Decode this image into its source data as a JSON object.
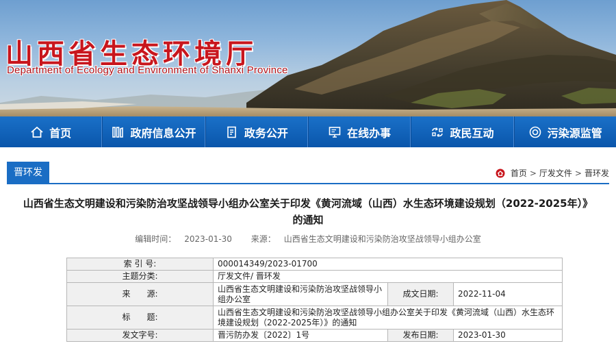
{
  "header": {
    "site_title": "山西省生态环境厅",
    "site_subtitle": "Department of Ecology and Environment of Shanxi Province"
  },
  "nav": {
    "items": [
      {
        "label": "首页",
        "icon": "home-icon"
      },
      {
        "label": "政府信息公开",
        "icon": "info-columns-icon"
      },
      {
        "label": "政务公开",
        "icon": "document-icon"
      },
      {
        "label": "在线办事",
        "icon": "monitor-icon"
      },
      {
        "label": "政民互动",
        "icon": "interaction-icon"
      },
      {
        "label": "污染源监管",
        "icon": "target-icon"
      }
    ]
  },
  "section": {
    "tag": "晋环发",
    "breadcrumb": [
      "首页",
      "厅发文件",
      "晋环发"
    ],
    "breadcrumb_sep": ">"
  },
  "article": {
    "title_line1": "山西省生态文明建设和污染防治攻坚战领导小组办公室关于印发《黄河流域（山西）水生态环境建设规划（2022-2025年）》",
    "title_line2": "的通知",
    "edit_time_label": "编辑时间：",
    "edit_time": "2023-01-30",
    "source_label": "来源：",
    "source": "山西省生态文明建设和污染防治攻坚战领导小组办公室"
  },
  "info": {
    "index_label": "索 引 号:",
    "index_value": "000014349/2023-01700",
    "category_label": "主题分类:",
    "category_value": "厅发文件/ 晋环发",
    "source_label": "来　　源:",
    "source_value": "山西省生态文明建设和污染防治攻坚战领导小组办公室",
    "created_label": "成文日期:",
    "created_value": "2022-11-04",
    "title_label": "标　　题:",
    "title_value": "山西省生态文明建设和污染防治攻坚战领导小组办公室关于印发《黄河流域（山西）水生态环境建设规划（2022-2025年）》的通知",
    "docno_label": "发文字号:",
    "docno_value": "晋污防办发〔2022〕1号",
    "published_label": "发布日期:",
    "published_value": "2023-01-30"
  },
  "colors": {
    "nav_blue": "#0a56ab",
    "accent_blue": "#1a6dc4",
    "title_red": "#c8161d"
  }
}
